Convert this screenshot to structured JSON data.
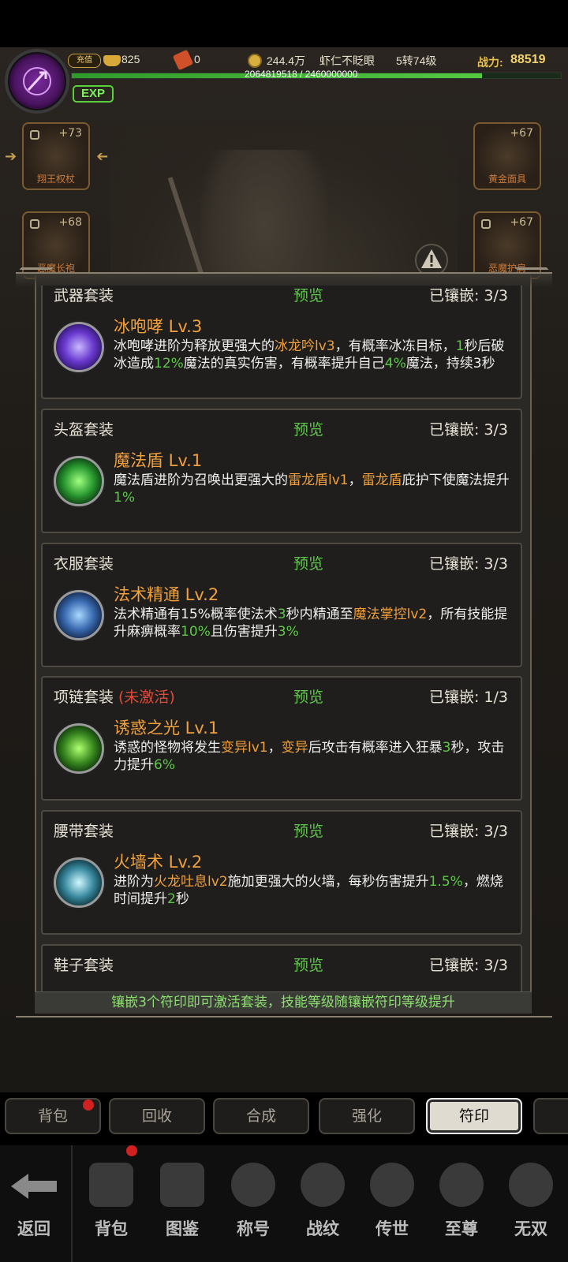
{
  "hud": {
    "charge_label": "充值",
    "ingot": "825",
    "tickets": "0",
    "coins": "244.4万",
    "player_name": "虾仁不眨眼",
    "rebirth_level": "5转74级",
    "power_label": "战力:",
    "power_value": "88519",
    "exp_text": "2064819518 / 2460000000",
    "exp_progress": 0.8394,
    "exp_badge": "EXP"
  },
  "equipment": {
    "left_top": {
      "name": "翔王权杖",
      "level": "+73"
    },
    "left_mid": {
      "name": "恶魔长袍",
      "level": "+68"
    },
    "right_top": {
      "name": "黄金面具",
      "level": "+67"
    },
    "right_mid": {
      "name": "恶魔护肩",
      "level": "+67"
    }
  },
  "panel": {
    "preview_label": "预览",
    "inlaid_label": "已镶嵌:",
    "inactive_label": "(未激活)",
    "footer": "镶嵌3个符印即可激活套装，技能等级随镶嵌符印等级提升",
    "sets": [
      {
        "title": "武器套装",
        "inlaid": "3/3",
        "skill": "冰咆哮 Lv.3",
        "desc": [
          {
            "t": "冰咆哮进阶为释放更强大的",
            "c": ""
          },
          {
            "t": "冰龙吟lv3",
            "c": "o"
          },
          {
            "t": "，有概率冰冻目标，",
            "c": ""
          },
          {
            "t": "1",
            "c": "g"
          },
          {
            "t": "秒后破冰造成",
            "c": ""
          },
          {
            "t": "12%",
            "c": "g"
          },
          {
            "t": "魔法的真实伤害，有概率提升自己",
            "c": ""
          },
          {
            "t": "4%",
            "c": "g"
          },
          {
            "t": "魔法，持续3秒",
            "c": ""
          }
        ]
      },
      {
        "title": "头盔套装",
        "inlaid": "3/3",
        "skill": "魔法盾 Lv.1",
        "desc": [
          {
            "t": "魔法盾进阶为召唤出更强大的",
            "c": ""
          },
          {
            "t": "雷龙盾lv1",
            "c": "o"
          },
          {
            "t": "，",
            "c": ""
          },
          {
            "t": "雷龙盾",
            "c": "o"
          },
          {
            "t": "庇护下使魔法提升",
            "c": ""
          },
          {
            "t": "1%",
            "c": "g"
          }
        ]
      },
      {
        "title": "衣服套装",
        "inlaid": "3/3",
        "skill": "法术精通 Lv.2",
        "desc": [
          {
            "t": "法术精通有15%概率使法术",
            "c": ""
          },
          {
            "t": "3",
            "c": "g"
          },
          {
            "t": "秒内精通至",
            "c": ""
          },
          {
            "t": "魔法掌控lv2",
            "c": "o"
          },
          {
            "t": "，所有技能提升麻痹概率",
            "c": ""
          },
          {
            "t": "10%",
            "c": "g"
          },
          {
            "t": "且伤害提升",
            "c": ""
          },
          {
            "t": "3%",
            "c": "g"
          }
        ]
      },
      {
        "title": "项链套装",
        "inactive": true,
        "inlaid": "1/3",
        "skill": "诱惑之光 Lv.1",
        "desc": [
          {
            "t": "诱惑的怪物将发生",
            "c": ""
          },
          {
            "t": "变异lv1",
            "c": "o"
          },
          {
            "t": "，",
            "c": ""
          },
          {
            "t": "变异",
            "c": "o"
          },
          {
            "t": "后攻击有概率进入狂暴",
            "c": ""
          },
          {
            "t": "3",
            "c": "g"
          },
          {
            "t": "秒，攻击力提升",
            "c": ""
          },
          {
            "t": "6%",
            "c": "g"
          }
        ]
      },
      {
        "title": "腰带套装",
        "inlaid": "3/3",
        "skill": "火墙术 Lv.2",
        "desc": [
          {
            "t": "进阶为",
            "c": ""
          },
          {
            "t": "火龙吐息lv2",
            "c": "o"
          },
          {
            "t": "施加更强大的火墙，每秒伤害提升",
            "c": ""
          },
          {
            "t": "1.5%",
            "c": "g"
          },
          {
            "t": "，燃烧时间提升",
            "c": ""
          },
          {
            "t": "2",
            "c": "g"
          },
          {
            "t": "秒",
            "c": ""
          }
        ]
      },
      {
        "title": "鞋子套装",
        "inlaid": "3/3",
        "skill": "",
        "desc": []
      }
    ]
  },
  "subtabs": [
    "背包",
    "回收",
    "合成",
    "强化",
    "符印"
  ],
  "nav": [
    "返回",
    "背包",
    "图鉴",
    "称号",
    "战纹",
    "传世",
    "至尊",
    "无双"
  ],
  "colors": {
    "accent_orange": "#f0a03c",
    "accent_green": "#5ec84a",
    "inactive_red": "#e04a3a"
  }
}
